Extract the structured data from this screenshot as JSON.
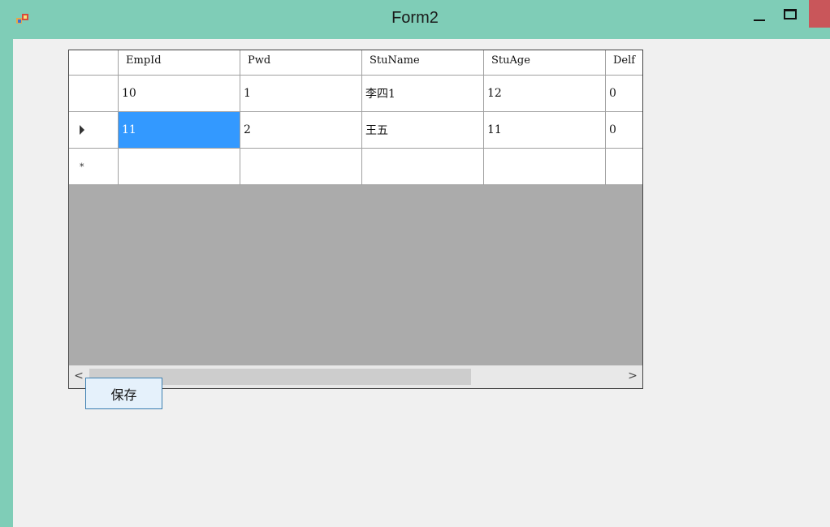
{
  "window": {
    "title": "Form2"
  },
  "grid": {
    "columns": [
      "EmpId",
      "Pwd",
      "StuName",
      "StuAge",
      "Delf"
    ],
    "rows": [
      [
        "10",
        "1",
        "李四1",
        "12",
        "0"
      ],
      [
        "11",
        "2",
        "王五",
        "11",
        "0"
      ]
    ],
    "new_row_marker": "*"
  },
  "scrollbar": {
    "left_arrow": "<",
    "right_arrow": ">"
  },
  "save_button": {
    "label": "保存"
  },
  "colors": {
    "titlebar": "#7fcdb7",
    "selection": "#3399ff",
    "grid_empty": "#ababab",
    "close_button": "#c9565a"
  }
}
